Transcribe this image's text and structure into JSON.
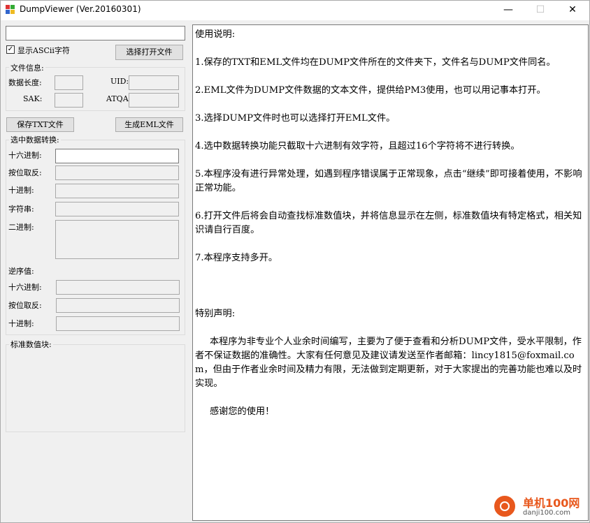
{
  "window": {
    "title": "DumpViewer (Ver.20160301)",
    "controls": {
      "minimize": "—",
      "maximize": "☐",
      "close": "✕"
    }
  },
  "left": {
    "show_ascii_label": "显示ASCii字符",
    "show_ascii_checked": "✓",
    "open_file_button": "选择打开文件",
    "file_info": {
      "title": "文件信息:",
      "data_length": "数据长度:",
      "uid": "UID:",
      "sak": "SAK:",
      "atqa": "ATQA:"
    },
    "save_txt_button": "保存TXT文件",
    "gen_eml_button": "生成EML文件",
    "convert": {
      "title": "选中数据转换:",
      "hex": "十六进制:",
      "bitwise_not": "按位取反:",
      "decimal": "十进制:",
      "string": "字符串:",
      "binary": "二进制:",
      "reverse_title": "逆序值:",
      "rev_hex": "十六进制:",
      "rev_bitwise_not": "按位取反:",
      "rev_decimal": "十进制:"
    },
    "std_block_title": "标准数值块:"
  },
  "main": {
    "lines": [
      "使用说明:",
      "",
      "1.保存的TXT和EML文件均在DUMP文件所在的文件夹下，文件名与DUMP文件同名。",
      "",
      "2.EML文件为DUMP文件数据的文本文件，提供给PM3使用，也可以用记事本打开。",
      "",
      "3.选择DUMP文件时也可以选择打开EML文件。",
      "",
      "4.选中数据转换功能只截取十六进制有效字符，且超过16个字符将不进行转换。",
      "",
      "5.本程序没有进行异常处理，如遇到程序错误属于正常现象，点击“继续”即可接着使用，不影响正常功能。",
      "",
      "6.打开文件后将会自动查找标准数值块，并将信息显示在左侧，标准数值块有特定格式，相关知识请自行百度。",
      "",
      "7.本程序支持多开。",
      "",
      "",
      "",
      "特别声明:",
      "",
      "     本程序为非专业个人业余时间编写，主要为了便于查看和分析DUMP文件，受水平限制，作者不保证数据的准确性。大家有任何意见及建议请发送至作者邮箱：lincy1815@foxmail.com，但由于作者业余时间及精力有限，无法做到定期更新，对于大家提出的完善功能也难以及时实现。",
      "",
      "     感谢您的使用！"
    ]
  },
  "watermark": {
    "brand": "单机100网",
    "url": "danji100.com"
  },
  "colors": {
    "window_bg": "#f0f0f0",
    "brand_orange": "#e8581d"
  }
}
